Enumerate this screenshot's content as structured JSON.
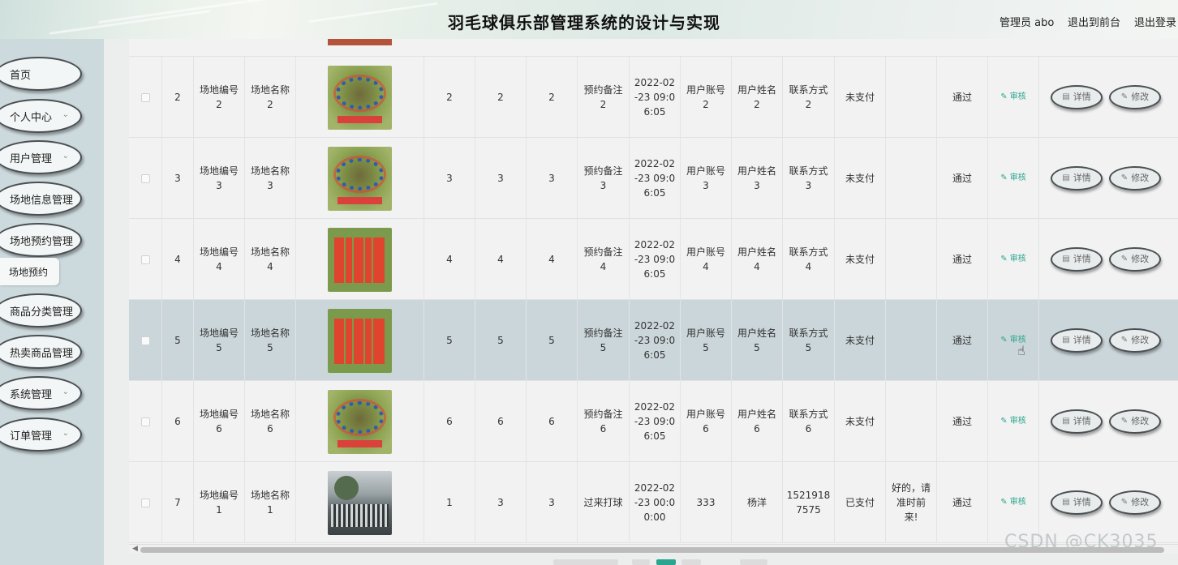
{
  "header": {
    "title": "羽毛球俱乐部管理系统的设计与实现",
    "user": "管理员 abo",
    "front": "退出到前台",
    "logout": "退出登录"
  },
  "sidebar": {
    "items": [
      {
        "label": "首页"
      },
      {
        "label": "个人中心"
      },
      {
        "label": "用户管理"
      },
      {
        "label": "场地信息管理"
      },
      {
        "label": "场地预约管理"
      },
      {
        "label": "商品分类管理"
      },
      {
        "label": "热卖商品管理"
      },
      {
        "label": "系统管理"
      },
      {
        "label": "订单管理"
      }
    ],
    "sub_item": "场地预约"
  },
  "table": {
    "audit_label": "审核",
    "detail_label": "详情",
    "edit_label": "修改",
    "rows": [
      {
        "idx": "2",
        "code": "场地编号\n2",
        "name": "场地名称\n2",
        "n1": "2",
        "n2": "2",
        "n3": "2",
        "note": "预约备注\n2",
        "time": "2022-02\n-23 09:0\n6:05",
        "acct": "用户账号\n2",
        "uname": "用户姓名\n2",
        "contact": "联系方式\n2",
        "pay": "未支付",
        "reply": "",
        "status": "通过",
        "img": "green"
      },
      {
        "idx": "3",
        "code": "场地编号\n3",
        "name": "场地名称\n3",
        "n1": "3",
        "n2": "3",
        "n3": "3",
        "note": "预约备注\n3",
        "time": "2022-02\n-23 09:0\n6:05",
        "acct": "用户账号\n3",
        "uname": "用户姓名\n3",
        "contact": "联系方式\n3",
        "pay": "未支付",
        "reply": "",
        "status": "通过",
        "img": "green"
      },
      {
        "idx": "4",
        "code": "场地编号\n4",
        "name": "场地名称\n4",
        "n1": "4",
        "n2": "4",
        "n3": "4",
        "note": "预约备注\n4",
        "time": "2022-02\n-23 09:0\n6:05",
        "acct": "用户账号\n4",
        "uname": "用户姓名\n4",
        "contact": "联系方式\n4",
        "pay": "未支付",
        "reply": "",
        "status": "通过",
        "img": "red"
      },
      {
        "idx": "5",
        "code": "场地编号\n5",
        "name": "场地名称\n5",
        "n1": "5",
        "n2": "5",
        "n3": "5",
        "note": "预约备注\n5",
        "time": "2022-02\n-23 09:0\n6:05",
        "acct": "用户账号\n5",
        "uname": "用户姓名\n5",
        "contact": "联系方式\n5",
        "pay": "未支付",
        "reply": "",
        "status": "通过",
        "img": "red",
        "highlight": true
      },
      {
        "idx": "6",
        "code": "场地编号\n6",
        "name": "场地名称\n6",
        "n1": "6",
        "n2": "6",
        "n3": "6",
        "note": "预约备注\n6",
        "time": "2022-02\n-23 09:0\n6:05",
        "acct": "用户账号\n6",
        "uname": "用户姓名\n6",
        "contact": "联系方式\n6",
        "pay": "未支付",
        "reply": "",
        "status": "通过",
        "img": "green"
      },
      {
        "idx": "7",
        "code": "场地编号\n1",
        "name": "场地名称\n1",
        "n1": "1",
        "n2": "3",
        "n3": "3",
        "note": "过来打球",
        "time": "2022-02\n-23 00:0\n0:00",
        "acct": "333",
        "uname": "杨洋",
        "contact": "1521918\n7575",
        "pay": "已支付",
        "reply": "好的，请\n准时前\n来!",
        "status": "通过",
        "img": "photo"
      }
    ]
  },
  "watermark": "CSDN @CK3035",
  "colors": {
    "accent": "#2aa58f",
    "highlight_row": "#cbd6da",
    "sidebar_bg": "#ccd9dd"
  }
}
